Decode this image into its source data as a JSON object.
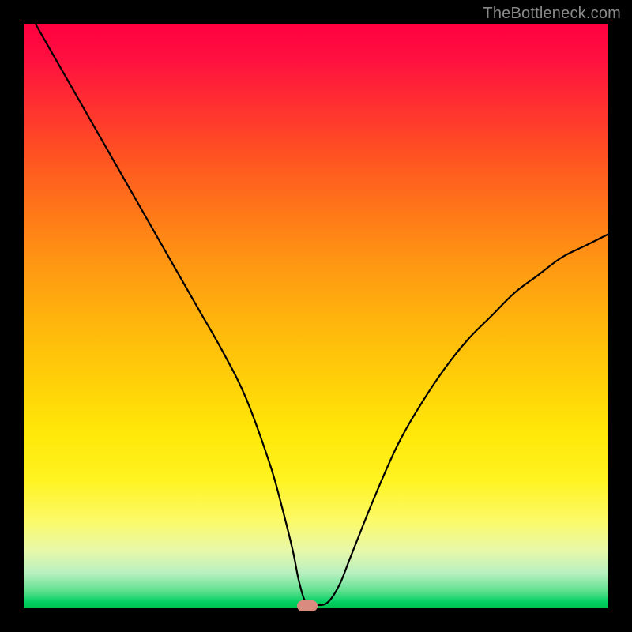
{
  "attribution": "TheBottleneck.com",
  "colors": {
    "frame": "#000000",
    "marker": "#d98b80",
    "curve": "#000000"
  },
  "chart_data": {
    "type": "line",
    "title": "",
    "xlabel": "",
    "ylabel": "",
    "xlim": [
      0,
      100
    ],
    "ylim": [
      0,
      100
    ],
    "background_gradient": {
      "direction": "vertical",
      "stops": [
        {
          "pos": 0,
          "color": "#ff0040"
        },
        {
          "pos": 50,
          "color": "#ffd000"
        },
        {
          "pos": 85,
          "color": "#fff860"
        },
        {
          "pos": 100,
          "color": "#00c050"
        }
      ]
    },
    "series": [
      {
        "name": "bottleneck-curve",
        "x": [
          2,
          6,
          10,
          14,
          18,
          22,
          26,
          30,
          34,
          38,
          42,
          44,
          46,
          47,
          48,
          49,
          50,
          52,
          54,
          56,
          60,
          64,
          68,
          72,
          76,
          80,
          84,
          88,
          92,
          96,
          100
        ],
        "y": [
          100,
          93,
          86,
          79,
          72,
          65,
          58,
          51,
          44,
          36,
          25,
          18,
          10,
          5,
          1.5,
          0.5,
          0.5,
          1,
          4,
          9,
          19,
          28,
          35,
          41,
          46,
          50,
          54,
          57,
          60,
          62,
          64
        ]
      }
    ],
    "marker": {
      "x": 48.5,
      "y": 0.4
    }
  }
}
